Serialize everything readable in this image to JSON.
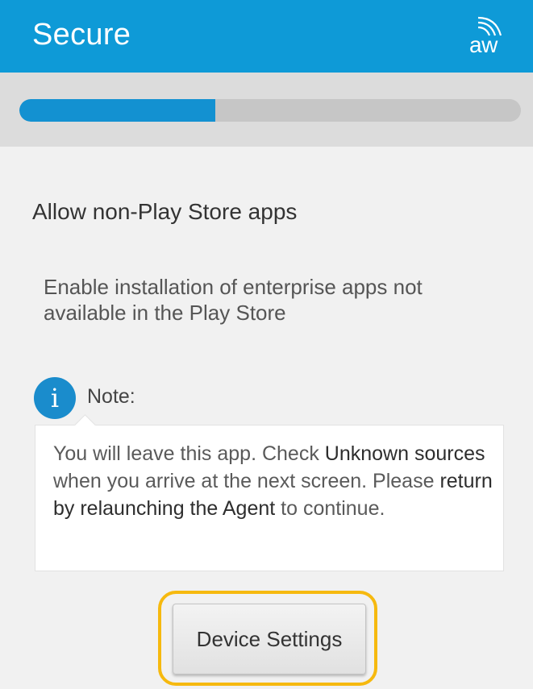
{
  "header": {
    "title": "Secure",
    "logo_text": "aw",
    "logo_icon": "wireless-waves-icon",
    "background_color": "#0e9ad7"
  },
  "progress": {
    "value_fraction": 0.39,
    "fill_color": "#1391d1",
    "track_color": "#c6c6c6"
  },
  "section": {
    "title": "Allow non-Play Store apps",
    "description": "Enable installation of enterprise apps not available in the Play Store"
  },
  "note": {
    "icon": "info-icon",
    "icon_glyph": "i",
    "label": "Note:",
    "text_part1": "You will leave this app. Check ",
    "text_bold1": "Unknown sources",
    "text_part2": " when you arrive at the next screen. Please ",
    "text_bold2": "return by relaunching the Agent",
    "text_part3": " to continue."
  },
  "actions": {
    "device_settings_label": "Device Settings",
    "highlight_color": "#f6b90f"
  }
}
